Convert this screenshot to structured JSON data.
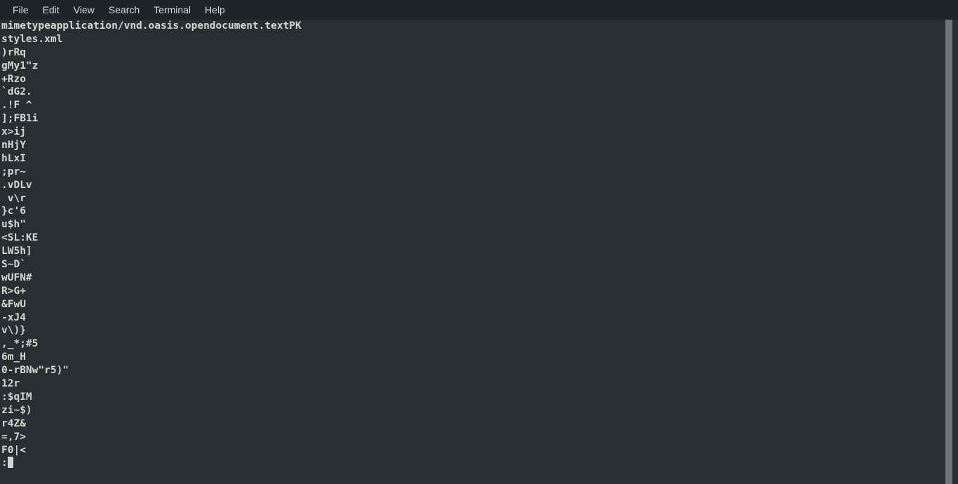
{
  "window": {
    "title": "Terminal",
    "background_color": "#272f32",
    "text_color": "#d3d7cf",
    "menubar_color": "#1c2428",
    "scrollbar_color": "#6e7375"
  },
  "menubar": {
    "items": [
      {
        "label": "File"
      },
      {
        "label": "Edit"
      },
      {
        "label": "View"
      },
      {
        "label": "Search"
      },
      {
        "label": "Terminal"
      },
      {
        "label": "Help"
      }
    ]
  },
  "terminal": {
    "lines": [
      "mimetypeapplication/vnd.oasis.opendocument.textPK",
      "styles.xml",
      ")rRq",
      "gMy1\"z",
      "+Rzo",
      "`dG2.",
      ".!F ^",
      "];FB1i",
      "x>ij",
      "nHjY",
      "hLxI",
      ";pr~",
      ".vDLv",
      " v\\r",
      "}c'6",
      "u$h\"",
      "<SL:KE",
      "LW5h]",
      "S~D`",
      "wUFN#",
      "R>G+",
      "&FwU",
      "-xJ4",
      "v\\)}",
      ",_*;#5",
      "6m_H",
      "0-rBNw\"r5)\"",
      "12r",
      ":$qIM",
      "zi~$)",
      "r4Z&",
      "=,7>",
      "F0|<"
    ],
    "prompt_line": ":",
    "cursor": "block"
  }
}
